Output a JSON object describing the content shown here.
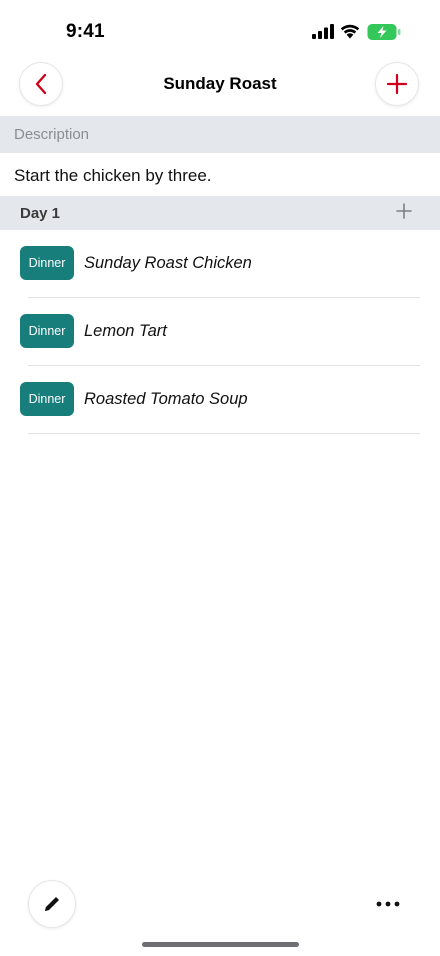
{
  "status_bar": {
    "time": "9:41",
    "icons": [
      "signal-icon",
      "wifi-icon",
      "battery-charging-icon"
    ],
    "battery_color": "#34c759"
  },
  "nav": {
    "title": "Sunday Roast",
    "back_icon": "chevron-left-icon",
    "add_icon": "plus-icon",
    "accent_color": "#d0021b"
  },
  "description": {
    "header": "Description",
    "text": "Start the chicken by three."
  },
  "day": {
    "label": "Day 1",
    "add_icon": "plus-icon"
  },
  "meals": [
    {
      "badge": "Dinner",
      "name": "Sunday Roast Chicken"
    },
    {
      "badge": "Dinner",
      "name": "Lemon Tart"
    },
    {
      "badge": "Dinner",
      "name": "Roasted Tomato Soup"
    }
  ],
  "badge_color": "#177e7b",
  "toolbar": {
    "edit_icon": "pencil-icon",
    "more_icon": "ellipsis-icon"
  }
}
